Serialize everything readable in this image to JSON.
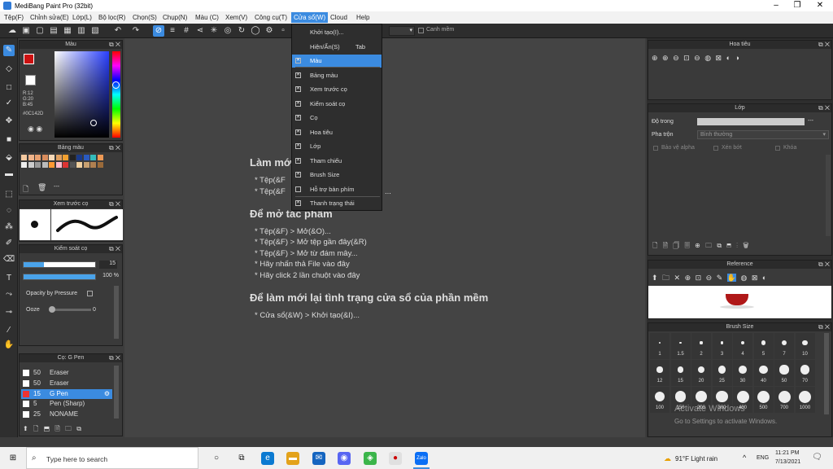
{
  "window": {
    "title": "MediBang Paint Pro (32bit)"
  },
  "menu": {
    "items": [
      "Tệp(F)",
      "Chỉnh sửa(E)",
      "Lớp(L)",
      "Bộ lọc(R)",
      "Chọn(S)",
      "Chụp(N)",
      "Màu (C)",
      "Xem(V)",
      "Công cụ(T)",
      "Cửa sổ(W)",
      "Cloud",
      "Help"
    ],
    "active": "Cửa sổ(W)"
  },
  "toolbar": {
    "snap_label": "Canh mềm"
  },
  "dropdown": {
    "items": [
      {
        "label": "Khởi tạo(I)...",
        "check": "none"
      },
      {
        "label": "Hiện/Ẩn(S)",
        "shortcut": "Tab",
        "check": "none"
      },
      {
        "label": "Màu",
        "check": "on"
      },
      {
        "label": "Bảng màu",
        "check": "on"
      },
      {
        "label": "Xem trước cọ",
        "check": "on"
      },
      {
        "label": "Kiểm soát cọ",
        "check": "on"
      },
      {
        "label": "Cọ",
        "check": "on"
      },
      {
        "label": "Hoa tiêu",
        "check": "on"
      },
      {
        "label": "Lớp",
        "check": "on"
      },
      {
        "label": "Tham chiếu",
        "check": "on"
      },
      {
        "label": "Brush Size",
        "check": "on"
      },
      {
        "label": "Hỗ trợ bàn phím",
        "check": "off"
      },
      {
        "label": "Thanh trạng thái",
        "check": "on"
      }
    ]
  },
  "color_panel": {
    "title": "Màu",
    "r": "R:12",
    "g": "G:20",
    "b": "B:45",
    "hex": "#0C142D",
    "fg_color": "#cc1111",
    "bg_color": "#ffffff"
  },
  "palette_panel": {
    "title": "Bảng màu",
    "add_label": "---"
  },
  "brush_preview_panel": {
    "title": "Xem trước cọ"
  },
  "brush_control_panel": {
    "title": "Kiểm soát cọ",
    "size_value": "15",
    "opacity_value": "100 %",
    "opacity_pressure_label": "Opacity by Pressure",
    "ooze_label": "Ooze",
    "ooze_value": "0",
    "size_fraction": 0.28,
    "opacity_fraction": 1.0
  },
  "brush_panel": {
    "title": "Cọ: G Pen",
    "rows": [
      {
        "size": "50",
        "name": "Eraser",
        "selected": false
      },
      {
        "size": "50",
        "name": "Eraser",
        "selected": false
      },
      {
        "size": "15",
        "name": "G Pen",
        "selected": true
      },
      {
        "size": "5",
        "name": "Pen (Sharp)",
        "selected": false
      },
      {
        "size": "25",
        "name": "NONAME",
        "selected": false
      }
    ]
  },
  "canvas": {
    "heading1": "Làm mới",
    "lines1": [
      "* Tệp(&F",
      "* Tệp(&F"
    ],
    "lines1_tail": "...",
    "heading2": "Để mở tác phẩm",
    "lines2": [
      "* Tệp(&F) > Mở(&O)...",
      "* Tệp(&F) > Mở tệp gần đây(&R)",
      "* Tệp(&F) > Mở từ đám mây...",
      "* Hãy nhấn thả File vào đây",
      "* Hãy click 2 lần chuột vào đây"
    ],
    "heading3": "Để làm mới lại tình trạng cửa sổ của phần mềm",
    "lines3": [
      "* Cửa sổ(&W) > Khởi tạo(&I)..."
    ]
  },
  "navigator_panel": {
    "title": "Hoa tiêu"
  },
  "layer_panel": {
    "title": "Lớp",
    "opacity_label": "Độ trong",
    "opacity_value": "---",
    "blend_label": "Pha trộn",
    "blend_value": "Bình thường",
    "protect_alpha": "Bảo vệ alpha",
    "clipping": "Xén bớt",
    "lock": "Khóa"
  },
  "reference_panel": {
    "title": "Reference"
  },
  "brush_size_panel": {
    "title": "Brush Size",
    "sizes": [
      "1",
      "1.5",
      "2",
      "3",
      "4",
      "5",
      "7",
      "10",
      "12",
      "15",
      "20",
      "25",
      "30",
      "40",
      "50",
      "70",
      "100",
      "150",
      "200",
      "300",
      "400",
      "500",
      "700",
      "1000"
    ]
  },
  "watermark": {
    "line1": "Activate Windows",
    "line2": "Go to Settings to activate Windows."
  },
  "taskbar": {
    "search_placeholder": "Type here to search",
    "weather": "91°F  Light rain",
    "lang": "ENG",
    "time": "11:21 PM",
    "date": "7/13/2021"
  }
}
